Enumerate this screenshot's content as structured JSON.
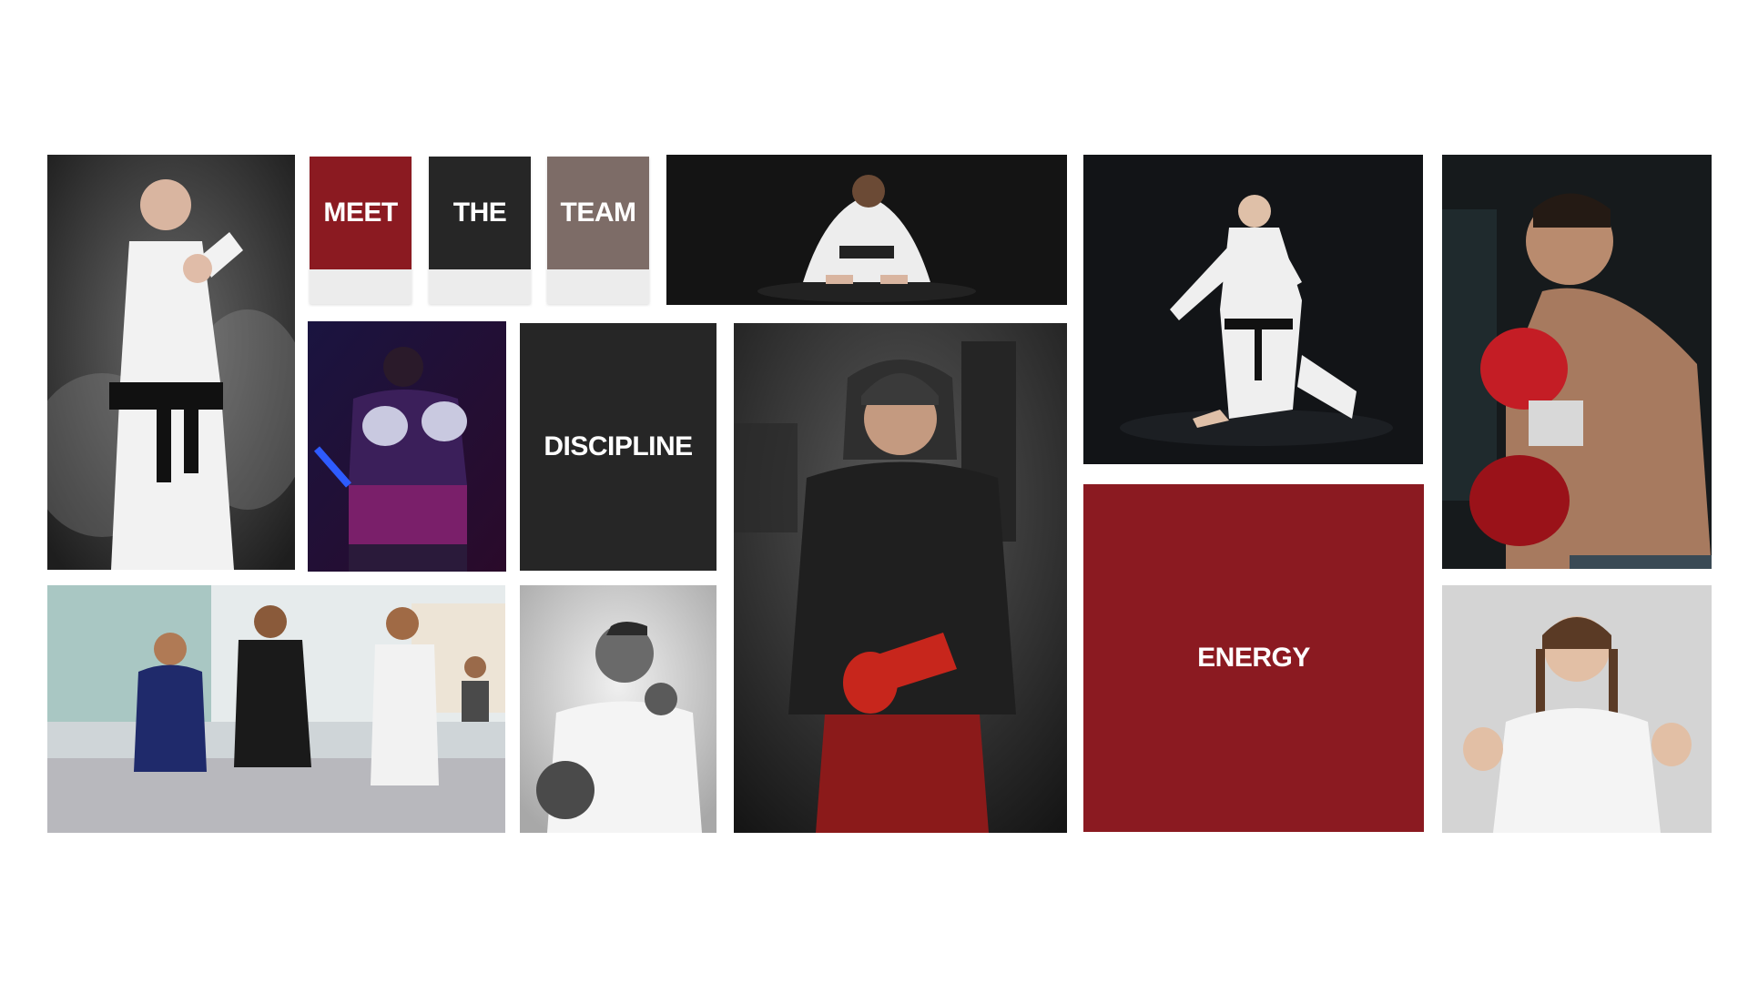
{
  "colors": {
    "accent_red": "#8b1a21",
    "charcoal": "#262626",
    "taupe": "#7d6c67",
    "paper": "#ececec"
  },
  "header_cards": [
    {
      "label": "MEET",
      "color": "#8b1a21"
    },
    {
      "label": "THE",
      "color": "#262626"
    },
    {
      "label": "TEAM",
      "color": "#7d6c67"
    }
  ],
  "text_tiles": {
    "discipline": "DISCIPLINE",
    "energy": "ENERGY"
  },
  "photos": [
    "karate-woman-punch-photo",
    "kneeling-bow-photo",
    "kneeling-girl-karate-photo",
    "boxer-red-gloves-photo",
    "neon-boxer-photo",
    "hooded-fighter-photo",
    "kids-bjj-class-photo",
    "bw-karate-punch-photo",
    "braided-karate-woman-photo"
  ]
}
